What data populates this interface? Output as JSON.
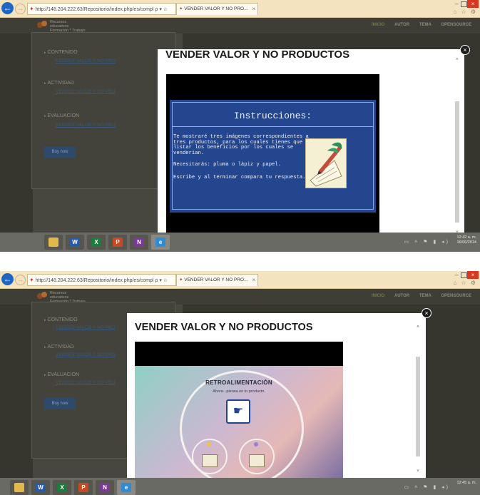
{
  "browser": {
    "address_url": "http://148.204.222.63/Repositorio/index.php/es/compl",
    "address_icons": "ρ ▾ ☆",
    "tab_title_1": "VENDER VALOR Y NO PRO...",
    "tab_title_2": "VENDER VALOR Y NO PRO...",
    "tab_close": "×",
    "back_glyph": "←",
    "forward_glyph": "→",
    "close_glyph": "×",
    "minimize_glyph": "–",
    "tools_glyphs": "⌂ ☆ ⚙"
  },
  "site": {
    "brand_lines": [
      "Recursos",
      "educativos",
      "Formación * Trabajo"
    ],
    "nav": [
      "INICIO",
      "AUTOR",
      "TEMA",
      "OPENSOURCE"
    ],
    "sections": [
      {
        "title": "CONTENIDO",
        "link": "VENDER VALOR Y NO PRO"
      },
      {
        "title": "ACTIVIDAD",
        "link": "VENDER VALOR Y NO PRO"
      },
      {
        "title": "EVALUACION",
        "link": "VENDER VALOR Y NO PRO"
      }
    ],
    "button_label": "Buy now"
  },
  "modal": {
    "title": "VENDER VALOR Y NO PRODUCTOS",
    "close_glyph": "×",
    "scroll_up": "˄",
    "scroll_down": "˅"
  },
  "slide1": {
    "heading": "Instrucciones:",
    "paragraph1": "Te mostraré tres imágenes correspondientes a tres productos, para  los cuales tienes que en listar los beneficios por los cuales se venderian.",
    "paragraph2": "Necesitarás: pluma o lápiz y papel.",
    "paragraph3": "Escribe y al terminar compara tu respuesta."
  },
  "slide2": {
    "heading": "RETROALIMENTACIÓN",
    "subheading": "Ahora...piensa en tu producto.",
    "hand_glyph": "☛"
  },
  "taskbar": {
    "apps": [
      {
        "name": "explorer",
        "letter": "",
        "color": "#e2b84a"
      },
      {
        "name": "word",
        "letter": "W",
        "color": "#2b5ba8"
      },
      {
        "name": "excel",
        "letter": "X",
        "color": "#1f7a3e"
      },
      {
        "name": "powerpoint",
        "letter": "P",
        "color": "#c84a24"
      },
      {
        "name": "onenote",
        "letter": "N",
        "color": "#7b3a96"
      },
      {
        "name": "internet-explorer",
        "letter": "e",
        "color": "#2f8bd6"
      }
    ],
    "clock_time_1": "12:42 a. m.",
    "clock_date_1": "16/06/2014",
    "clock_time_2": "12:45 a. m."
  },
  "colors": {
    "chrome_bg": "#f4e3bf",
    "slide1_bg": "#24468f",
    "page_dim": "#36362f",
    "close_red": "#d9381e"
  }
}
